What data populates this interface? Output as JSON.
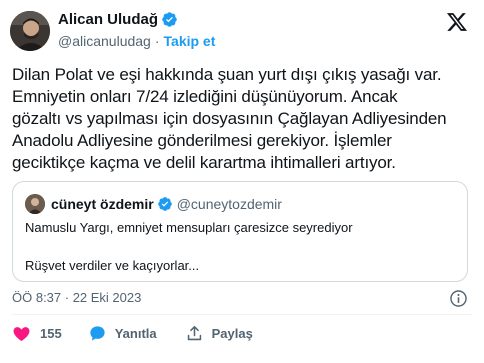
{
  "author": {
    "name": "Alican Uludağ",
    "handle": "@alicanuludag",
    "separator": "·",
    "follow_label": "Takip et"
  },
  "tweet": {
    "lines": [
      "Dilan Polat ve eşi hakkında şuan yurt dışı çıkış yasağı var.",
      "Emniyetin onları 7/24 izlediğini düşünüyorum. Ancak",
      "gözaltı vs yapılması için dosyasının Çağlayan Adliyesinden",
      "Anadolu Adliyesine gönderilmesi gerekiyor. İşlemler",
      "geciktikçe kaçma ve delil karartma ihtimalleri artıyor."
    ]
  },
  "quote": {
    "name": "cüneyt özdemir",
    "handle": "@cuneytozdemir",
    "line1": "Namuslu Yargı, emniyet mensupları çaresizce seyrediyor",
    "line2": "Rüşvet verdiler ve kaçıyorlar..."
  },
  "meta": {
    "timestamp": "ÖÖ 8:37 · 22 Eki 2023"
  },
  "actions": {
    "like_count": "155",
    "reply_label": "Yanıtla",
    "share_label": "Paylaş"
  },
  "colors": {
    "accent": "#1d9bf0",
    "like": "#f91880",
    "secondary_text": "#536471",
    "border": "#cfd9de"
  },
  "icons": [
    "verified-badge-icon",
    "x-logo-icon",
    "info-icon",
    "heart-icon",
    "reply-bubble-icon",
    "share-icon"
  ]
}
